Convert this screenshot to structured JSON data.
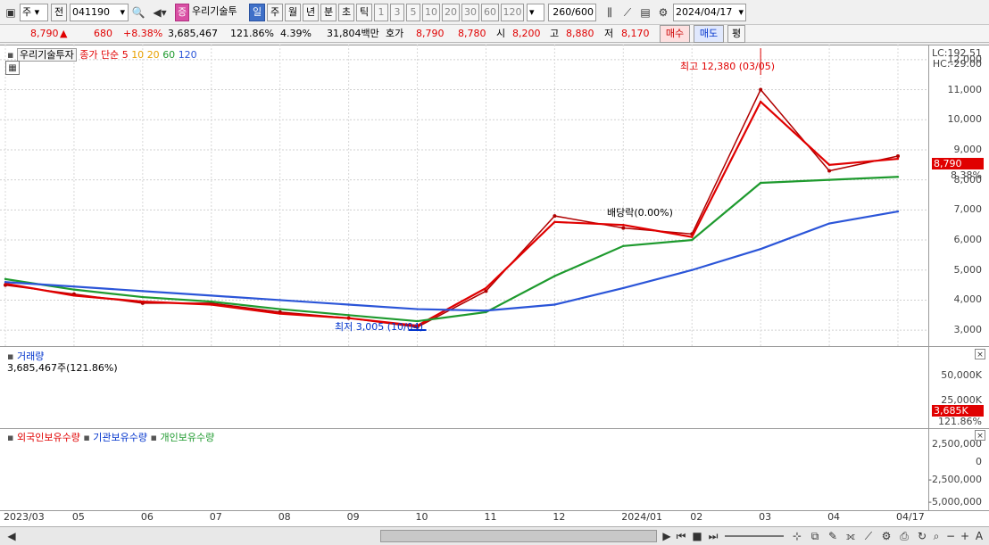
{
  "toolbar": {
    "market_select": "주",
    "prev_label": "전",
    "code": "041190",
    "badge": "증",
    "stock_name": "우리기술투",
    "periods": [
      "일",
      "주",
      "월",
      "년",
      "분",
      "초",
      "틱"
    ],
    "period_active": "일",
    "steps": [
      "1",
      "3",
      "5",
      "10",
      "20",
      "30",
      "60",
      "120"
    ],
    "count": "260",
    "count_max": "/600",
    "date": "2024/04/17"
  },
  "quote": {
    "price": "8,790",
    "arrow": "▲",
    "change": "680",
    "change_pct": "+8.38%",
    "volume": "3,685,467",
    "volume_ratio": "121.86%",
    "turnover": "4.39%",
    "amount": "31,804백만",
    "bid_label": "호가",
    "ask": "8,790",
    "bid": "8,780",
    "open_label": "시",
    "open": "8,200",
    "high_label": "고",
    "high": "8,880",
    "low_label": "저",
    "low": "8,170",
    "buy_label": "매수",
    "sell_label": "매도",
    "eval_label": "평"
  },
  "price_pane": {
    "stock_name": "우리기술투자",
    "ma_title": "종가 단순",
    "ma_periods": [
      "5",
      "10",
      "20",
      "60",
      "120"
    ],
    "ma_colors": [
      "#e00000",
      "#e8a000",
      "#e8a000",
      "#1e9a2e",
      "#2b55d8"
    ],
    "lc": "LC:192.51",
    "hc": "HC:-29.00",
    "ticks": [
      "12,000",
      "11,000",
      "10,000",
      "9,000",
      "8,000",
      "7,000",
      "6,000",
      "5,000",
      "4,000",
      "3,000"
    ],
    "last_price": "8,790",
    "last_pct": "8.38%",
    "high_note": "최고 12,380 (03/05)",
    "low_note": "최저 3,005 (10/04)",
    "dividend_note": "배당락(0.00%)"
  },
  "volume_pane": {
    "title": "거래량",
    "value": "3,685,467주(121.86%)",
    "ticks": [
      "50,000K",
      "25,000K"
    ],
    "last_tag": "3,685K",
    "last_pct": "121.86%"
  },
  "holding_pane": {
    "foreign": "외국인보유수량",
    "institution": "기관보유수량",
    "individual": "개인보유수량",
    "ticks": [
      "2,500,000",
      "0",
      "-2,500,000",
      "-5,000,000"
    ]
  },
  "x_axis": [
    "2023/03",
    "05",
    "06",
    "07",
    "08",
    "09",
    "10",
    "11",
    "12",
    "2024/01",
    "02",
    "03",
    "04",
    "04/17"
  ],
  "chart_data": {
    "type": "line",
    "title": "우리기술투자",
    "x": [
      "2023/03",
      "05",
      "06",
      "07",
      "08",
      "09",
      "10",
      "11",
      "12",
      "2024/01",
      "02",
      "03",
      "04",
      "04/17"
    ],
    "series": [
      {
        "name": "종가",
        "values": [
          4500,
          4200,
          3900,
          3900,
          3600,
          3400,
          3100,
          4300,
          6800,
          6400,
          6200,
          11000,
          8300,
          8790
        ]
      },
      {
        "name": "5",
        "values": [
          4550,
          4150,
          3950,
          3850,
          3550,
          3400,
          3150,
          4400,
          6600,
          6500,
          6100,
          10600,
          8500,
          8700
        ]
      },
      {
        "name": "60",
        "values": [
          4700,
          4350,
          4100,
          3950,
          3700,
          3500,
          3300,
          3600,
          4800,
          5800,
          6000,
          7900,
          8000,
          8100
        ]
      },
      {
        "name": "120",
        "values": [
          4600,
          4450,
          4300,
          4150,
          4000,
          3850,
          3700,
          3650,
          3850,
          4400,
          5000,
          5700,
          6550,
          6950
        ]
      }
    ],
    "ylim": [
      2500,
      12500
    ],
    "high": {
      "label": "최고",
      "value": 12380,
      "date": "03/05"
    },
    "low": {
      "label": "최저",
      "value": 3005,
      "date": "10/04"
    }
  }
}
